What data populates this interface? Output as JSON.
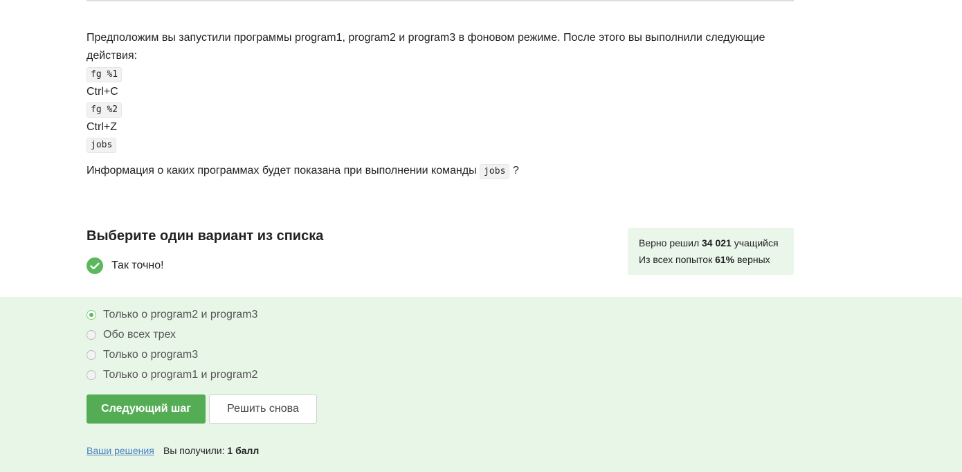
{
  "question": {
    "intro": "Предположим вы запустили программы program1, program2 и program3 в фоновом режиме. После этого вы выполнили следующие действия:",
    "steps": [
      "fg %1",
      "Ctrl+C",
      "fg %2",
      "Ctrl+Z",
      "jobs"
    ],
    "prompt_before": "Информация о каких программах будет показана при выполнении команды",
    "prompt_code": "jobs",
    "prompt_after": "?"
  },
  "quiz": {
    "heading": "Выберите один вариант из списка",
    "feedback": "Так точно!"
  },
  "stats": {
    "line1_prefix": "Верно решил",
    "solved_count": "34 021",
    "line1_suffix": "учащийся",
    "line2_prefix": "Из всех попыток",
    "percent": "61%",
    "line2_suffix": "верных"
  },
  "options": [
    {
      "label": "Только о program2 и program3",
      "selected": true
    },
    {
      "label": "Обо всех трех",
      "selected": false
    },
    {
      "label": "Только о program3",
      "selected": false
    },
    {
      "label": "Только о program1 и program2",
      "selected": false
    }
  ],
  "actions": {
    "next_label": "Следующий шаг",
    "retry_label": "Решить снова"
  },
  "footer": {
    "solutions_link": "Ваши решения",
    "score_prefix": "Вы получили:",
    "score_value": "1 балл"
  },
  "colors": {
    "accent_green": "#54ad54",
    "panel_bg": "#e8f6e8",
    "link_blue": "#4a7fc1"
  }
}
